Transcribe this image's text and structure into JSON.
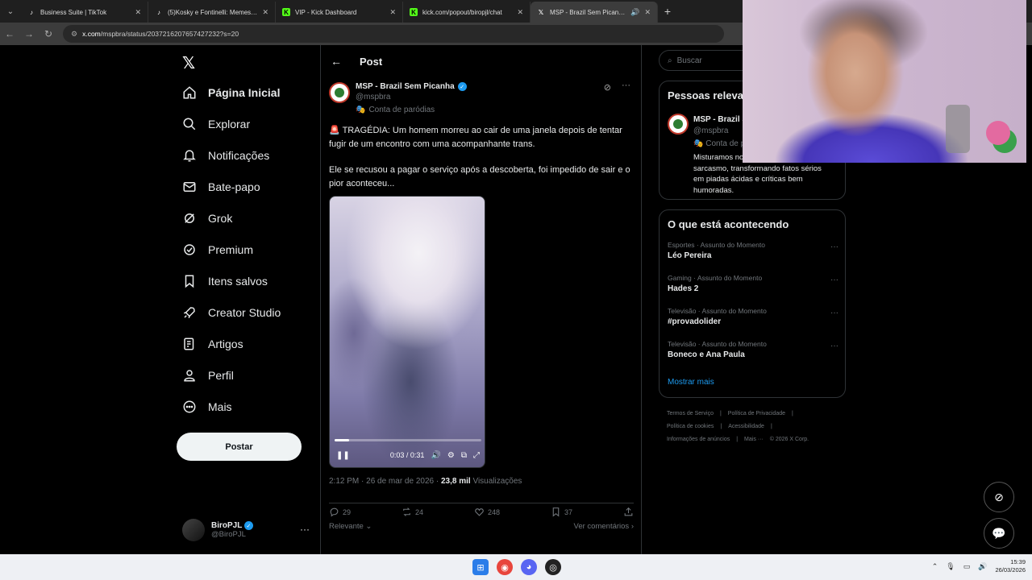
{
  "browser": {
    "tabs": [
      {
        "title": "Business Suite | TikTok",
        "icon": "tiktok-icon",
        "active": false
      },
      {
        "title": "(5)Kosky e Fontinelli: Memes e...",
        "icon": "tiktok-icon",
        "active": false
      },
      {
        "title": "VIP - Kick Dashboard",
        "icon": "kick-icon",
        "active": false
      },
      {
        "title": "kick.com/popout/biropjl/chat",
        "icon": "kick-icon",
        "active": false
      },
      {
        "title": "MSP - Brazil Sem Picanha n...",
        "icon": "x-icon",
        "active": true
      }
    ],
    "url_host": "x.com",
    "url_path": "/mspbra/status/2037216207657427232?s=20"
  },
  "nav": {
    "items": [
      {
        "label": "Página Inicial",
        "icon": "home-icon"
      },
      {
        "label": "Explorar",
        "icon": "search-icon"
      },
      {
        "label": "Notificações",
        "icon": "bell-icon"
      },
      {
        "label": "Bate-papo",
        "icon": "mail-icon"
      },
      {
        "label": "Grok",
        "icon": "grok-icon"
      },
      {
        "label": "Premium",
        "icon": "premium-icon"
      },
      {
        "label": "Itens salvos",
        "icon": "bookmark-icon"
      },
      {
        "label": "Creator Studio",
        "icon": "rocket-icon"
      },
      {
        "label": "Artigos",
        "icon": "article-icon"
      },
      {
        "label": "Perfil",
        "icon": "person-icon"
      },
      {
        "label": "Mais",
        "icon": "more-circle-icon"
      }
    ],
    "post_button": "Postar",
    "account": {
      "name": "BiroPJL",
      "handle": "@BiroPJL"
    }
  },
  "post": {
    "header": "Post",
    "author_name": "MSP - Brazil Sem Picanha",
    "author_handle": "@mspbra",
    "parody_label": "Conta de paródias",
    "text_1": "TRAGÉDIA: Um homem morreu ao cair de uma janela depois de tentar fugir de um encontro com uma acompanhante trans.",
    "alarm_emoji": "🚨",
    "text_2": "Ele se recusou a pagar o serviço após a descoberta, foi impedido de sair e o pior aconteceu...",
    "video_time": "0:03 / 0:31",
    "video_progress": 0.097,
    "timestamp": "2:12 PM · 26 de mar de 2026 · ",
    "views_count": "23,8 mil",
    "views_label": " Visualizações",
    "replies": "29",
    "reposts": "24",
    "likes": "248",
    "bookmarks": "37",
    "sort_label": "Relevante",
    "view_comments": "Ver comentários"
  },
  "right": {
    "search_placeholder": "Buscar",
    "relevant_title": "Pessoas relevantes",
    "relevant_name": "MSP - Brazil Sem Picanha",
    "relevant_handle": "@mspbra",
    "relevant_parody": "Conta de paródias",
    "relevant_bio": "Misturamos notícias com ironia e sarcasmo, transformando fatos sérios em piadas ácidas e críticas bem humoradas.",
    "trends_title": "O que está acontecendo",
    "trends": [
      {
        "category": "Esportes · Assunto do Momento",
        "name": "Léo Pereira"
      },
      {
        "category": "Gaming · Assunto do Momento",
        "name": "Hades 2"
      },
      {
        "category": "Televisão · Assunto do Momento",
        "name": "#provadolider"
      },
      {
        "category": "Televisão · Assunto do Momento",
        "name": "Boneco e Ana Paula"
      }
    ],
    "show_more": "Mostrar mais",
    "footer": [
      "Termos de Serviço",
      "|",
      "Política de Privacidade",
      "|",
      "Política de cookies",
      "|",
      "Acessibilidade",
      "|",
      "Informações de anúncios",
      "|",
      "Mais ···",
      "© 2026 X Corp."
    ]
  },
  "taskbar": {
    "time": "15:39",
    "date": "26/03/2026"
  }
}
